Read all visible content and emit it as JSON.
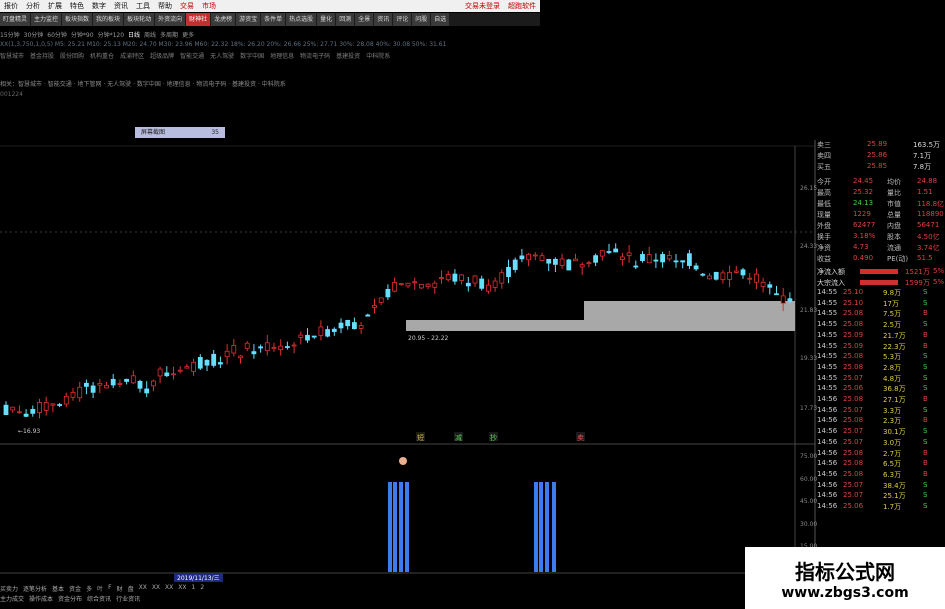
{
  "menu": {
    "items": [
      "报价",
      "分析",
      "扩展",
      "特色",
      "数字",
      "资讯",
      "工具",
      "帮助"
    ],
    "highlight_items": [
      "交易",
      "市场"
    ],
    "right_items": [
      "交易未登录",
      "超跑软件"
    ]
  },
  "toolbar": {
    "buttons": [
      "盯盘精灵",
      "主力监控",
      "板块指数",
      "我的板块",
      "板块轮动",
      "外资流向",
      "财神社",
      "龙虎榜",
      "游资宝",
      "条件单",
      "热点选股",
      "量化",
      "回测",
      "全景",
      "资讯",
      "评论",
      "问股",
      "自选"
    ],
    "active_index": 6
  },
  "periods": {
    "items": [
      "15分钟",
      "30分钟",
      "60分钟",
      "分钟*90",
      "分钟*120",
      "日线",
      "周线",
      "多周期",
      "更多"
    ],
    "active_index": 5
  },
  "info_line": "XX(1,3,750,1,0,5)   M5: 25.21   M10: 25.13   M20: 24.70   M30: 23.96   M60: 22.32   18%: 26.20   20%: 26.66   25%: 27.71   30%: 28.08   40%: 30.08   50%: 31.61",
  "concepts": [
    "智慧城市",
    "基金持股",
    "股份回购",
    "机构重仓",
    "成渝特区",
    "超级品牌",
    "智能交通",
    "无人驾驶",
    "数字中国",
    "地理信息",
    "物流电子码",
    "基建投资",
    "中科院系"
  ],
  "concept_line2": "相关：智慧城市 · 智能交通 · 地下管网 · 无人驾驶 · 数字中国 · 地理信息 · 物流电子码 · 基建投资 · 中科院系",
  "code_line": "001224",
  "screen_button": {
    "label": "屏幕截图",
    "value": "35"
  },
  "price_axis": [
    "26.15",
    "24.33",
    "21.83",
    "19.33",
    "17.73"
  ],
  "price_annotations": {
    "low": "16.93",
    "band": "20.95 - 22.22"
  },
  "signal_labels": [
    "短",
    "减",
    "抄",
    "卖"
  ],
  "volume_axis": [
    "75.00",
    "60.00",
    "45.00",
    "30.00",
    "15.00"
  ],
  "side_panel": {
    "quotes": [
      {
        "label": "卖三",
        "price": "25.89",
        "vol": "163.5万"
      },
      {
        "label": "卖四",
        "price": "25.86",
        "vol": "7.1万"
      },
      {
        "label": "买五",
        "price": "25.85",
        "vol": "7.8万"
      }
    ],
    "stats": [
      {
        "label": "今开",
        "value": "24.45",
        "label2": "均价",
        "value2": "24.88"
      },
      {
        "label": "最高",
        "value": "25.32",
        "label2": "量比",
        "value2": "1.51"
      },
      {
        "label": "最低",
        "value": "24.13",
        "label2": "市值",
        "value2": "118.8亿"
      },
      {
        "label": "现量",
        "value": "1229",
        "label2": "总量",
        "value2": "118890"
      },
      {
        "label": "外盘",
        "value": "62477",
        "label2": "内盘",
        "value2": "56471"
      },
      {
        "label": "换手",
        "value": "3.18%",
        "label2": "股本",
        "value2": "4.50亿"
      },
      {
        "label": "净资",
        "value": "4.73",
        "label2": "流通",
        "value2": "3.74亿"
      },
      {
        "label": "收益",
        "value": "0.490",
        "label2": "PE(动)",
        "value2": "51.5"
      }
    ],
    "flows": [
      {
        "label": "净流入额",
        "value": "1521万",
        "pct": "5%"
      },
      {
        "label": "大宗流入",
        "value": "1599万",
        "pct": "5%"
      }
    ],
    "ticks": [
      {
        "t": "14:55",
        "p": "25.10",
        "v": "9.8万",
        "f": "S"
      },
      {
        "t": "14:55",
        "p": "25.10",
        "v": "17万",
        "f": "S"
      },
      {
        "t": "14:55",
        "p": "25.08",
        "v": "7.5万",
        "f": "B"
      },
      {
        "t": "14:55",
        "p": "25.08",
        "v": "2.5万",
        "f": "S"
      },
      {
        "t": "14:55",
        "p": "25.09",
        "v": "21.7万",
        "f": "B"
      },
      {
        "t": "14:55",
        "p": "25.09",
        "v": "22.3万",
        "f": "B"
      },
      {
        "t": "14:55",
        "p": "25.08",
        "v": "5.3万",
        "f": "S"
      },
      {
        "t": "14:55",
        "p": "25.08",
        "v": "2.8万",
        "f": "S"
      },
      {
        "t": "14:55",
        "p": "25.07",
        "v": "4.8万",
        "f": "S"
      },
      {
        "t": "14:55",
        "p": "25.06",
        "v": "36.8万",
        "f": "S"
      },
      {
        "t": "14:56",
        "p": "25.08",
        "v": "27.1万",
        "f": "B"
      },
      {
        "t": "14:56",
        "p": "25.07",
        "v": "3.3万",
        "f": "S"
      },
      {
        "t": "14:56",
        "p": "25.08",
        "v": "2.3万",
        "f": "B"
      },
      {
        "t": "14:56",
        "p": "25.07",
        "v": "30.1万",
        "f": "S"
      },
      {
        "t": "14:56",
        "p": "25.07",
        "v": "3.0万",
        "f": "S"
      },
      {
        "t": "14:56",
        "p": "25.08",
        "v": "2.7万",
        "f": "B"
      },
      {
        "t": "14:56",
        "p": "25.08",
        "v": "6.5万",
        "f": "B"
      },
      {
        "t": "14:56",
        "p": "25.08",
        "v": "6.3万",
        "f": "B"
      },
      {
        "t": "14:56",
        "p": "25.07",
        "v": "38.4万",
        "f": "S"
      },
      {
        "t": "14:56",
        "p": "25.07",
        "v": "25.1万",
        "f": "S"
      },
      {
        "t": "14:56",
        "p": "25.06",
        "v": "1.7万",
        "f": "S"
      }
    ]
  },
  "date_tag": "2019/11/13/三",
  "bottom_tabs": [
    "买卖力",
    "逐笔分析",
    "基本",
    "资金",
    "多",
    "叶",
    "F",
    "财",
    "盘",
    "XX",
    "XX",
    "XX",
    "XX",
    "1",
    "2"
  ],
  "bottom_tabs2": [
    "主力成交",
    "操作成本",
    "资金分布",
    "综合资讯",
    "行业资讯"
  ],
  "colors": {
    "up": "#e03030",
    "down": "#66e0ff",
    "bar": "#3c7cf0",
    "band": "#a8a8a8"
  },
  "watermark": {
    "title": "指标公式网",
    "url": "www.zbgs3.com"
  }
}
